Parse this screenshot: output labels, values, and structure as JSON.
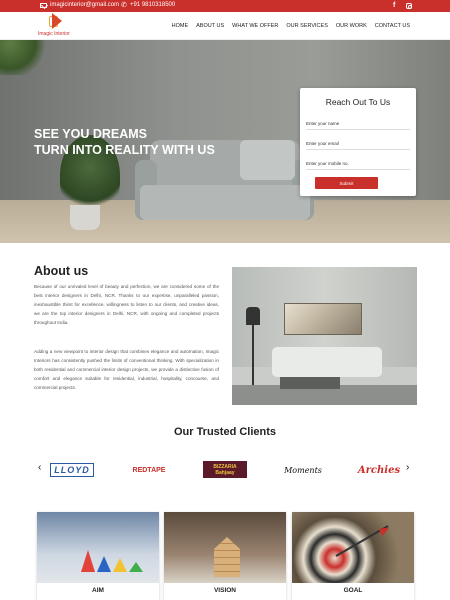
{
  "topbar": {
    "email": "imagicinterior@gmail.com",
    "phone": "+91 9810318500",
    "social": [
      "facebook-icon",
      "instagram-icon"
    ]
  },
  "header": {
    "logo_text": "Imagic Interior",
    "nav": [
      "HOME",
      "ABOUT US",
      "WHAT WE OFFER",
      "OUR SERVICES",
      "OUR WORK",
      "CONTACT US"
    ]
  },
  "hero": {
    "line1": "SEE YOU DREAMS",
    "line2": "TURN INTO REALITY WITH US"
  },
  "contact_form": {
    "title": "Reach Out To Us",
    "name_placeholder": "Enter your name",
    "email_placeholder": "Enter your email",
    "mobile_placeholder": "Enter your mobile no.",
    "submit_label": "Submit"
  },
  "about": {
    "heading": "About us",
    "paragraph1": "Because of our unrivaled level of beauty and perfection, we are considered some of the best interior designers in Delhi, NCR. Thanks to our expertise, unparalleled passion, inexhaustible thirst for excellence, willingness to listen to our clients, and creative ideas, we are the top interior designers in Delhi, NCR, with ongoing and completed projects throughout India.",
    "paragraph2": "Adding a new viewpoint to interior design that combines elegance and automation, Imagic Interiors has consistently pushed the limits of conventional thinking. With specialization in both residential and commercial interior design projects, we provide a distinctive fusion of comfort and elegance suitable for residential, industrial, hospitality, concourse, and commercial projects."
  },
  "clients": {
    "heading": "Our Trusted Clients",
    "prev": "‹",
    "next": "›",
    "logos": [
      "LLOYD",
      "REDTAPE",
      "BIZZARIA",
      "Bahjaay",
      "Moments",
      "Archies"
    ]
  },
  "cards": [
    "AIM",
    "VISION",
    "GOAL"
  ],
  "colors": {
    "accent": "#c9302c",
    "topbar": "#c9302c"
  }
}
